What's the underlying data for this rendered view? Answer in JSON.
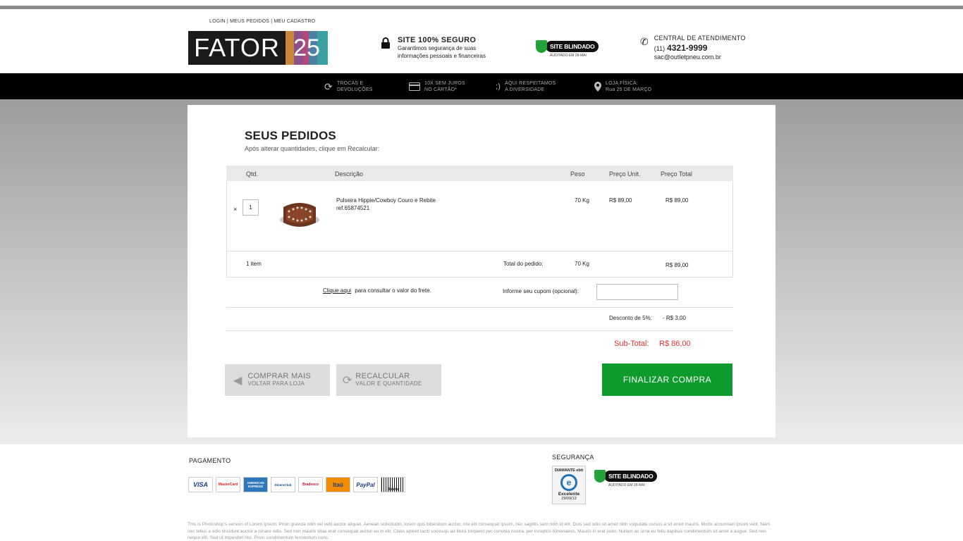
{
  "header": {
    "top_links": "LOGIN | MEUS PEDIDOS | MEU CADASTRO",
    "logo_text": "FATOR",
    "logo_number": "25",
    "secure_title": "SITE 100% SEGURO",
    "secure_line1": "Garantimos segurança de suas",
    "secure_line2": "informações pessoais e financeiras",
    "blindado_label": "SITE BLINDADO",
    "blindado_sub": "AUDITADO EM 28-MAI",
    "contact_title": "CENTRAL DE ATENDIMENTO",
    "contact_ddd": "(11)",
    "contact_phone": "4321-9999",
    "contact_email": "sac@outletpneu.com.br"
  },
  "navbar": [
    {
      "icon": "refresh-icon",
      "line1": "TROCAS E",
      "line2": "DEVOLUÇÕES"
    },
    {
      "icon": "card-icon",
      "line1": "10X SEM JUROS",
      "line2": "NO CARTÃO*"
    },
    {
      "icon": "wink-icon",
      "line1": "AQUI RESPEITAMOS",
      "line2": "A DIVERSIDADE"
    },
    {
      "icon": "pin-icon",
      "line1": "LOJA FÍSICA:",
      "line2": "Rua 25 DE MARÇO"
    }
  ],
  "cart": {
    "title": "SEUS PEDIDOS",
    "subtitle": "Após alterar quantidades, clique em Recalcular:",
    "columns": {
      "qty": "Qtd.",
      "desc": "Descrição",
      "weight": "Peso",
      "unit": "Preço Unit.",
      "total": "Preço Total"
    },
    "item": {
      "remove": "×",
      "qty": "1",
      "name": "Pulseira Hippie/Cowboy Couro e Rebite",
      "ref": "ref.65874521",
      "weight": "70 Kg",
      "unit_price": "R$ 89,00",
      "total_price": "R$ 89,00"
    },
    "summary": {
      "count": "1 item",
      "total_label": "Total do pedido:",
      "total_weight": "70 Kg",
      "total_price": "R$ 89,00"
    },
    "freight_link": "Clique aqui",
    "freight_text": "para consultar o valor do frete.",
    "coupon_label": "Informe seu cupom (opcional):",
    "coupon_value": "",
    "discount_label": "Desconto de 5%:",
    "discount_value": "- R$ 3,00",
    "subtotal_label": "Sub-Total:",
    "subtotal_value": "R$ 86,00"
  },
  "buttons": {
    "more_l1": "COMPRAR MAIS",
    "more_l2": "VOLTAR PARA LOJA",
    "recalc_l1": "RECALCULAR",
    "recalc_l2": "VALOR E QUANTIDADE",
    "finish": "FINALIZAR  COMPRA"
  },
  "footer": {
    "payment_title": "PAGAMENTO",
    "cards": [
      "VISA",
      "MasterCard",
      "AMERICAN EXPRESS",
      "DinersClub",
      "Bradesco",
      "Itaú",
      "PayPal",
      "Boleto"
    ],
    "security_title": "SEGURANÇA",
    "ebit_top": "DIAMANTE ebit",
    "ebit_letter": "e",
    "ebit_label": "Excelente",
    "ebit_date": "29/09/13",
    "lorem": "This is Photoshop's version  of Lorem Ipsum. Proin gravida nibh vel velit auctor aliquet. Aenean sollicitudin, lorem quis bibendum auctor, nisi elit consequat ipsum, nec sagittis sem nibh id elit. Duis sed odio sit amet nibh vulputate cursus a sit amet mauris. Morbi accumsan ipsum velit. Nam nec tellus a odio tincidunt auctor a ornare odio. Sed non  mauris vitae erat consequat auctor eu in elit. Class aptent taciti sociosqu ad litora torquent per conubia nostra, per inceptos himenaeos. Mauris in erat justo. Nullam ac urna eu felis dapibus condimentum sit amet a augue. Sed non neque elit. Sed ut imperdiet nisi. Proin condimentum fermentum nunc."
  }
}
